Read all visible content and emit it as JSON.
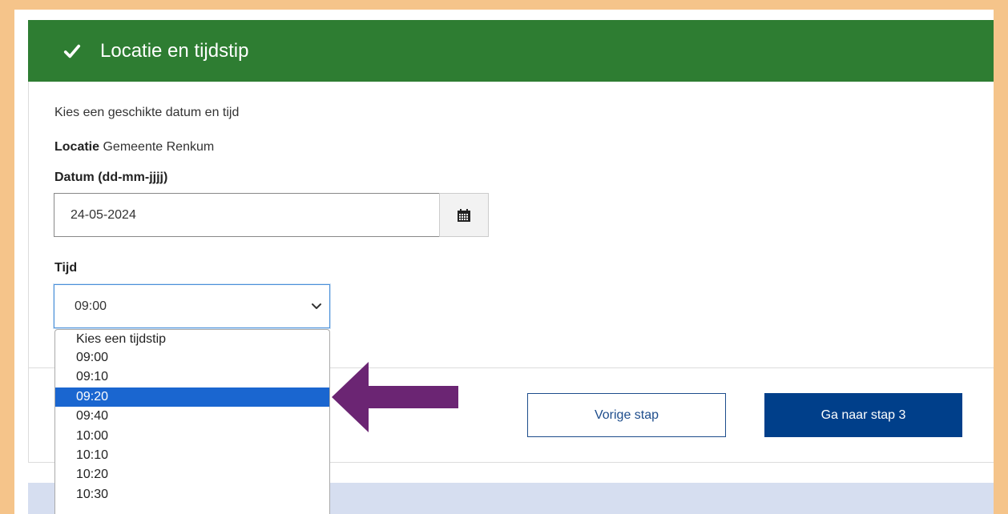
{
  "header": {
    "title": "Locatie en tijdstip"
  },
  "form": {
    "intro": "Kies een geschikte datum en tijd",
    "location_label": "Locatie",
    "location_value": "Gemeente Renkum",
    "date_label": "Datum (dd-mm-jjjj)",
    "date_value": "24-05-2024",
    "time_label": "Tijd",
    "time_selected": "09:00"
  },
  "dropdown": {
    "options": [
      "Kies een tijdstip",
      "09:00",
      "09:10",
      "09:20",
      "09:40",
      "10:00",
      "10:10",
      "10:20",
      "10:30"
    ],
    "highlighted": "09:20"
  },
  "buttons": {
    "prev": "Vorige stap",
    "next": "Ga naar stap 3"
  },
  "colors": {
    "header": "#2e7d32",
    "primary_button": "#003f8a",
    "highlight": "#1a66d0",
    "arrow": "#6b2573",
    "frame": "#f5c48a"
  }
}
